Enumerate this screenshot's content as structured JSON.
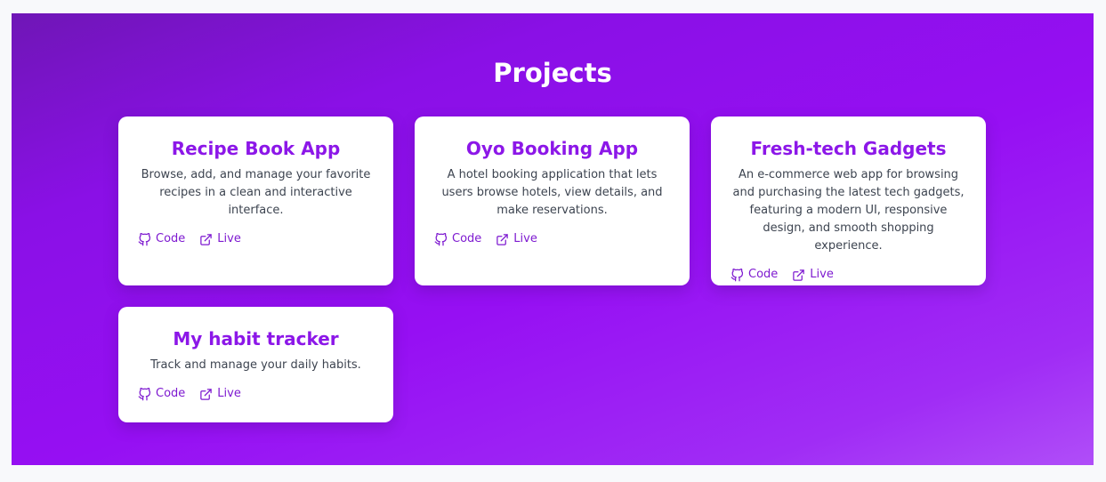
{
  "section": {
    "title": "Projects"
  },
  "projects": [
    {
      "title": "Recipe Book App",
      "description": "Browse, add, and manage your favorite recipes in a clean and interactive interface.",
      "code_label": "Code",
      "live_label": "Live"
    },
    {
      "title": "Oyo Booking App",
      "description": "A hotel booking application that lets users browse hotels, view details, and make reservations.",
      "code_label": "Code",
      "live_label": "Live"
    },
    {
      "title": "Fresh-tech Gadgets",
      "description": "An e-commerce web app for browsing and purchasing the latest tech gadgets, featuring a modern UI, responsive design, and smooth shopping experience.",
      "code_label": "Code",
      "live_label": "Live"
    },
    {
      "title": "My habit tracker",
      "description": "Track and manage your daily habits.",
      "code_label": "Code",
      "live_label": "Live"
    }
  ],
  "icons": {
    "code": "github-icon",
    "live": "external-link-icon"
  },
  "colors": {
    "accent": "#8c17e8",
    "link": "#7e1ad0",
    "background_start": "#6f16b6",
    "background_end": "#b04ef8"
  }
}
